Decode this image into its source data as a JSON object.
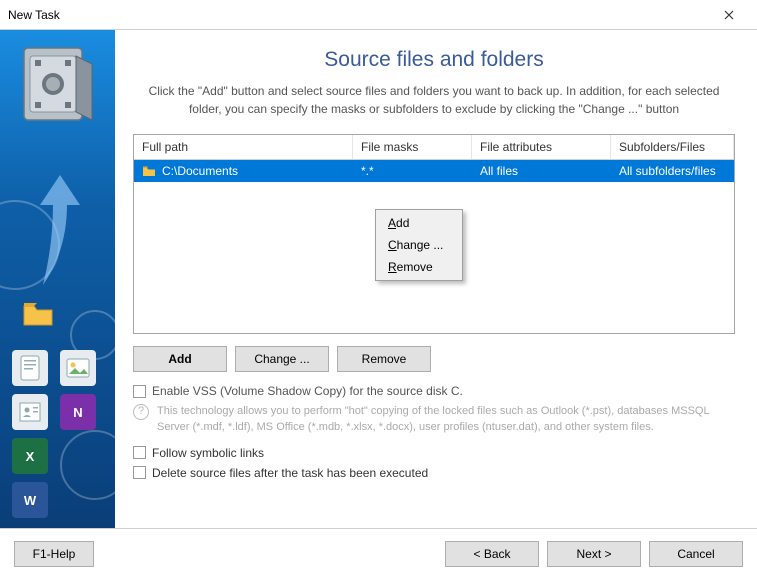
{
  "window": {
    "title": "New Task"
  },
  "heading": "Source files and folders",
  "description": "Click the \"Add\" button and select source files and folders you want to back up. In addition, for each selected folder, you can specify the masks or subfolders to exclude by clicking the \"Change ...\" button",
  "grid": {
    "headers": {
      "path": "Full path",
      "masks": "File masks",
      "attr": "File attributes",
      "sub": "Subfolders/Files"
    },
    "rows": [
      {
        "path": "C:\\Documents",
        "masks": "*.*",
        "attr": "All files",
        "sub": "All subfolders/files"
      }
    ]
  },
  "context_menu": {
    "add": "Add",
    "change": "Change ...",
    "remove": "Remove"
  },
  "buttons": {
    "add": "Add",
    "change": "Change ...",
    "remove": "Remove"
  },
  "vss": {
    "label": "Enable VSS (Volume Shadow Copy) for the source disk C.",
    "help": "This technology allows you to perform \"hot\" copying of the locked files such as Outlook (*.pst), databases MSSQL Server (*.mdf, *.ldf), MS Office (*.mdb, *.xlsx, *.docx), user profiles (ntuser.dat), and other system files."
  },
  "follow_symlinks": "Follow symbolic links",
  "delete_source": "Delete source files after the task has been executed",
  "footer": {
    "help": "F1-Help",
    "back": "< Back",
    "next": "Next >",
    "cancel": "Cancel"
  }
}
